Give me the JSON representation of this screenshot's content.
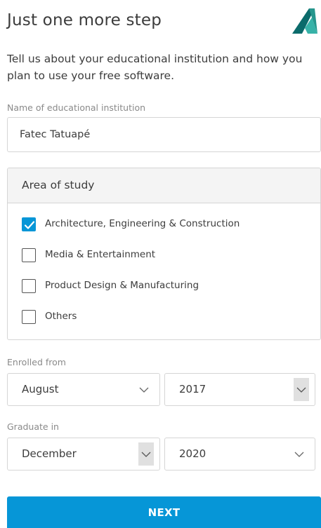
{
  "header": {
    "title": "Just one more step"
  },
  "intro": "Tell us about your educational institution and how you plan to use your free software.",
  "institution": {
    "label": "Name of educational institution",
    "value": "Fatec Tatuapé"
  },
  "area_of_study": {
    "heading": "Area of study",
    "options": [
      {
        "label": "Architecture, Engineering & Construction",
        "checked": true
      },
      {
        "label": "Media & Entertainment",
        "checked": false
      },
      {
        "label": "Product Design & Manufacturing",
        "checked": false
      },
      {
        "label": "Others",
        "checked": false
      }
    ]
  },
  "enrolled_from": {
    "label": "Enrolled from",
    "month": "August",
    "year": "2017"
  },
  "graduate_in": {
    "label": "Graduate in",
    "month": "December",
    "year": "2020"
  },
  "next_button": {
    "label": "NEXT"
  },
  "colors": {
    "accent": "#0696d7",
    "logo_dark": "#0b6b6b",
    "logo_light": "#37b2a8"
  },
  "icons": {
    "logo": "autodesk-logo-icon",
    "checkmark": "checkmark-icon",
    "dropdown": "chevron-down-icon"
  }
}
